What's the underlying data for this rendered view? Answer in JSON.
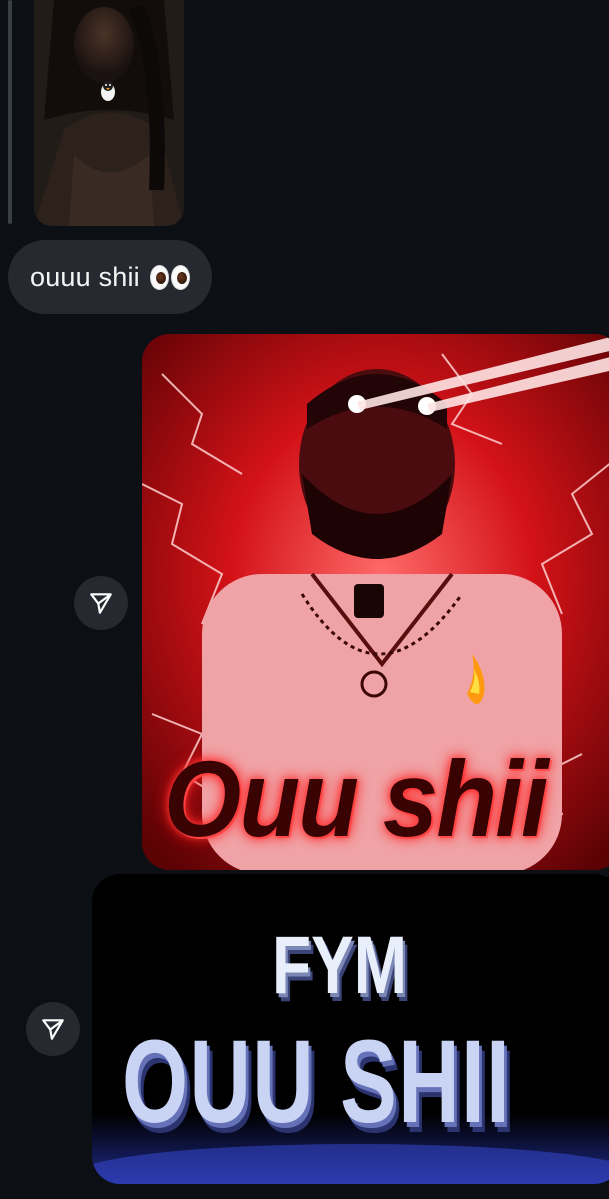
{
  "conversation": {
    "story_reply": {
      "thumbnail_icon": "penguin-sticker"
    },
    "incoming_message": {
      "text": "ouuu shii",
      "emoji": "👀"
    },
    "outgoing_media": [
      {
        "caption_text": "Ouu shii",
        "share_icon": "send-icon"
      },
      {
        "caption_line1": "FYM",
        "caption_line2": "OUU SHII",
        "share_icon": "send-icon"
      }
    ]
  },
  "colors": {
    "background": "#0c1014",
    "bubble": "#262a30",
    "text": "#f5f5f5",
    "red_media": "#d0141c",
    "blue_text": "#c9d3f3"
  }
}
